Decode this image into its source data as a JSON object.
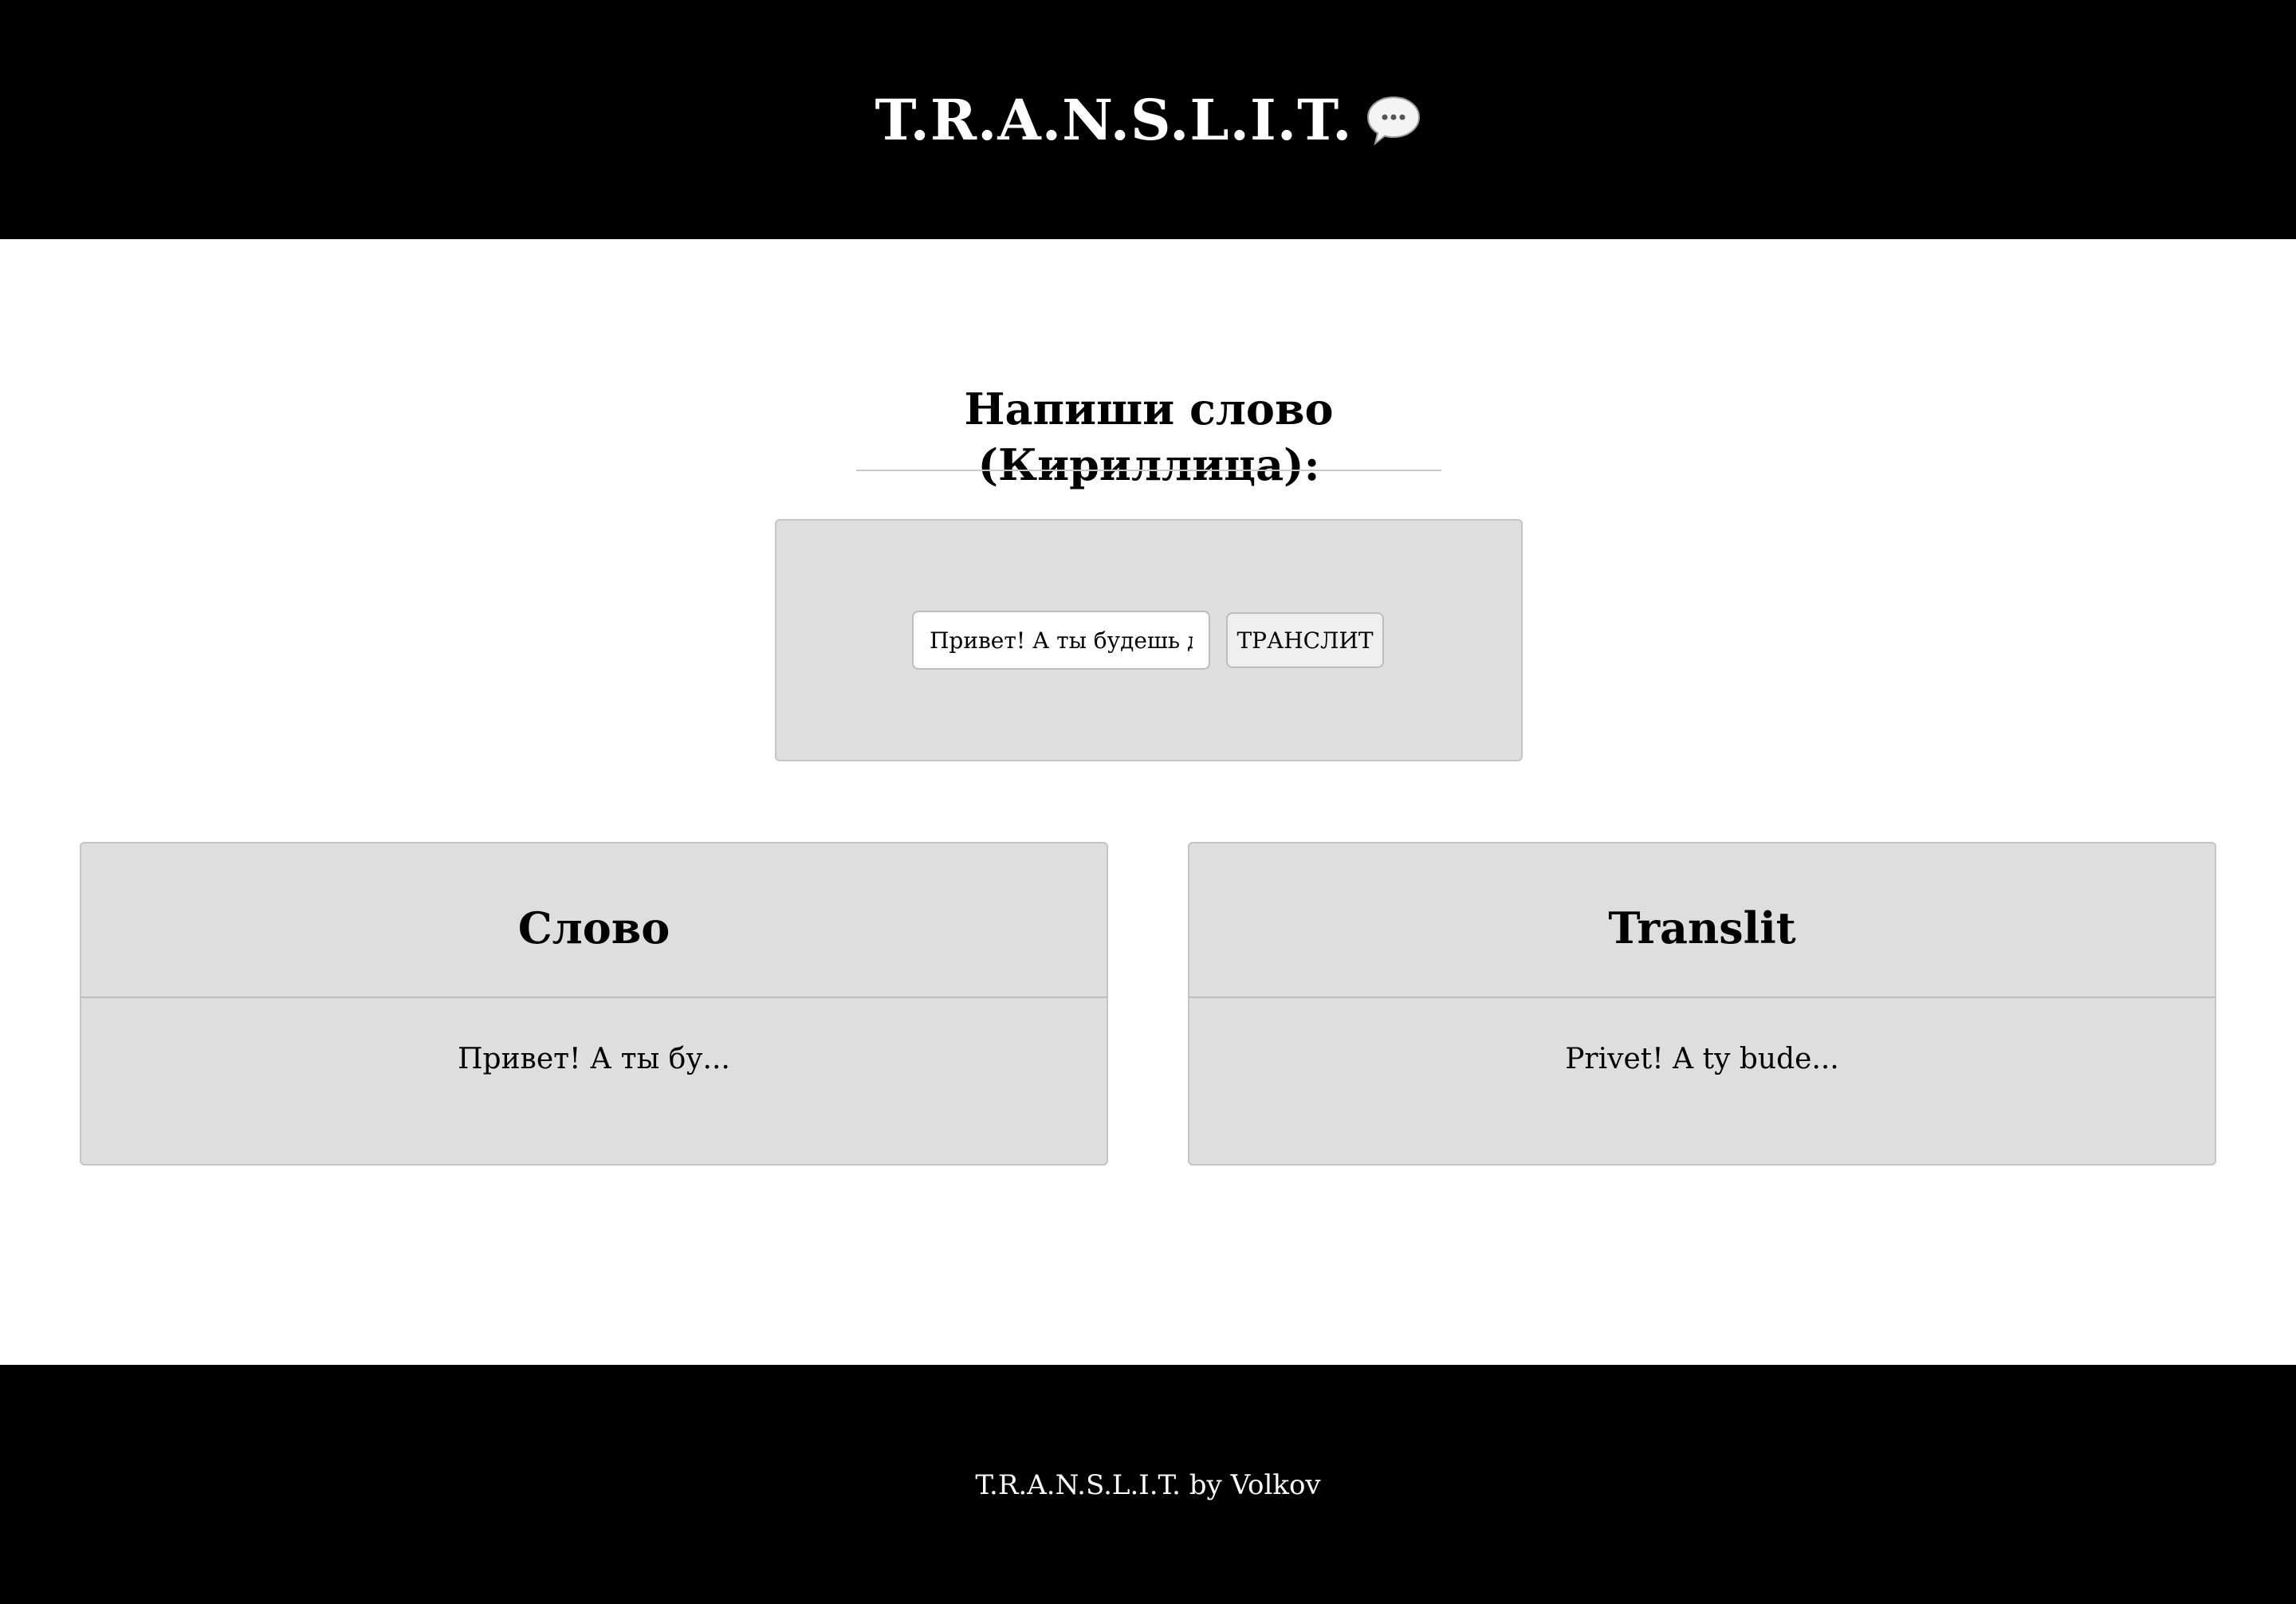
{
  "header": {
    "title": "T.R.A.N.S.L.I.T.",
    "icon": "speech-bubble-icon"
  },
  "main": {
    "heading": "Напиши слово (Кириллица):",
    "input_value": "Привет! А ты будешь де",
    "button_label": "ТРАНСЛИТ"
  },
  "cards": {
    "word": {
      "title": "Слово",
      "value": "Привет! А ты бу..."
    },
    "translit": {
      "title": "Translit",
      "value": "Privet! A ty bude..."
    }
  },
  "footer": {
    "text": "T.R.A.N.S.L.I.T. by Volkov"
  },
  "colors": {
    "header_bg": "#000000",
    "panel_bg": "#dedede",
    "page_bg": "#ffffff"
  }
}
